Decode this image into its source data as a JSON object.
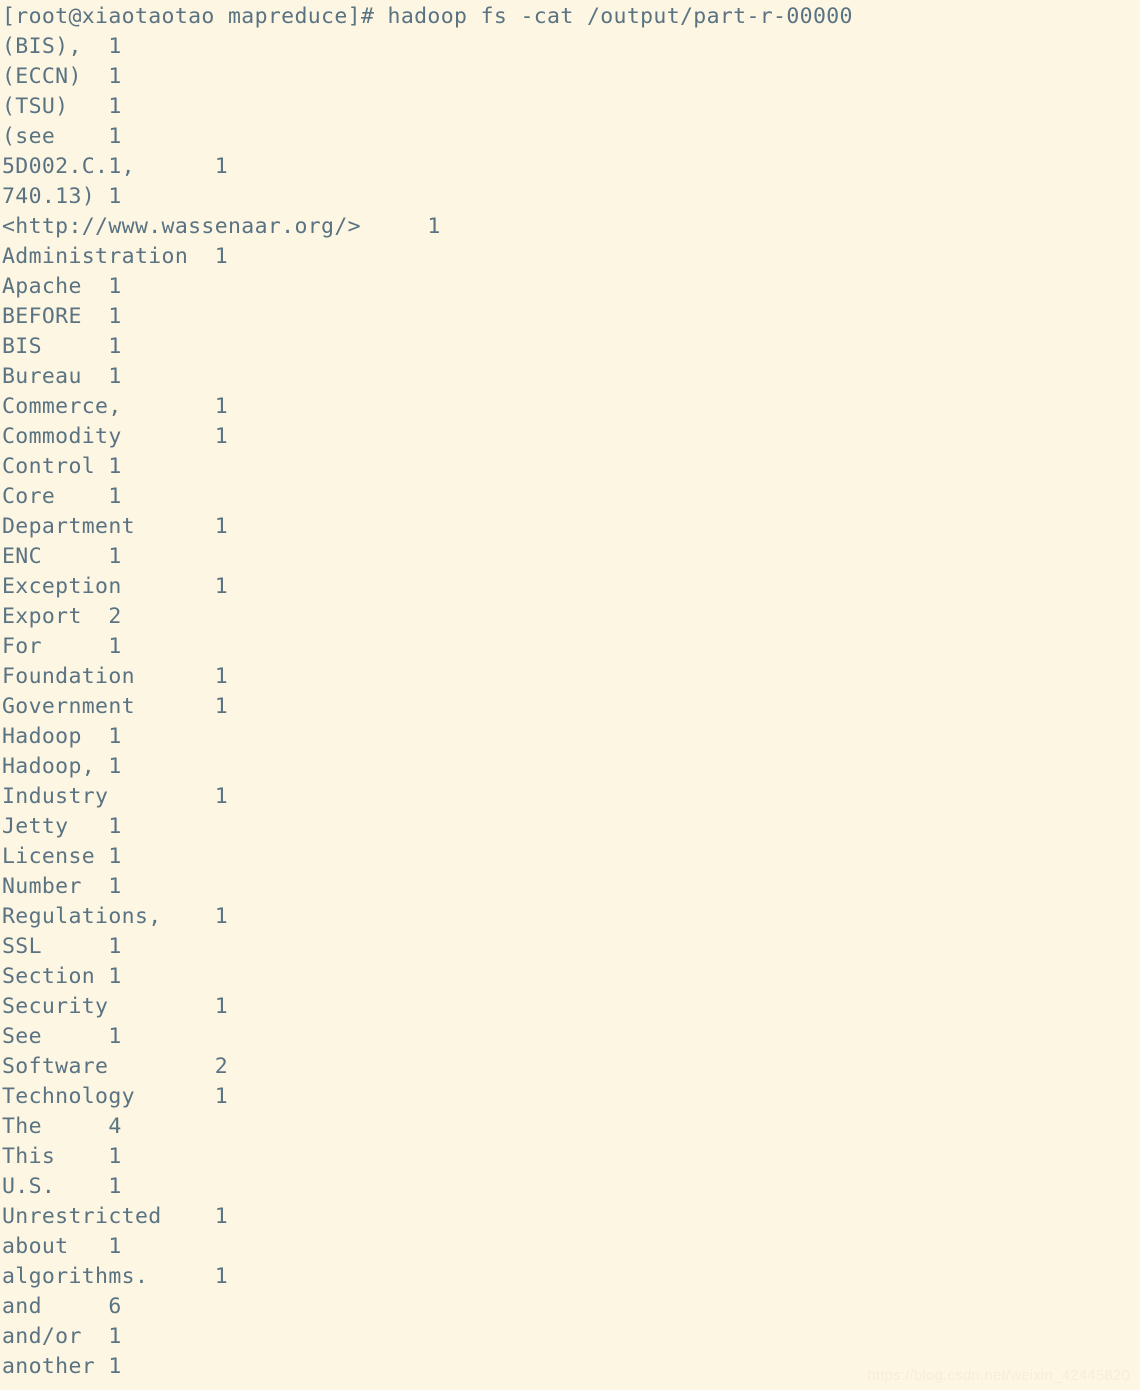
{
  "terminal": {
    "background_color": "#fdf6e3",
    "foreground_color": "#5a7383",
    "prompt": "[root@xiaotaotao mapreduce]# ",
    "command": "hadoop fs -cat /output/part-r-00000",
    "prompt_line": "[root@xiaotaotao mapreduce]# hadoop fs -cat /output/part-r-00000",
    "user": "root",
    "host": "xiaotaotao",
    "cwd": "mapreduce",
    "output_lines": [
      "(BIS),\t1",
      "(ECCN)\t1",
      "(TSU)\t1",
      "(see\t1",
      "5D002.C.1,\t1",
      "740.13)\t1",
      "<http://www.wassenaar.org/>\t1",
      "Administration\t1",
      "Apache\t1",
      "BEFORE\t1",
      "BIS\t1",
      "Bureau\t1",
      "Commerce,\t1",
      "Commodity\t1",
      "Control\t1",
      "Core\t1",
      "Department\t1",
      "ENC\t1",
      "Exception\t1",
      "Export\t2",
      "For\t1",
      "Foundation\t1",
      "Government\t1",
      "Hadoop\t1",
      "Hadoop,\t1",
      "Industry\t1",
      "Jetty\t1",
      "License\t1",
      "Number\t1",
      "Regulations,\t1",
      "SSL\t1",
      "Section\t1",
      "Security\t1",
      "See\t1",
      "Software\t2",
      "Technology\t1",
      "The\t4",
      "This\t1",
      "U.S.\t1",
      "Unrestricted\t1",
      "about\t1",
      "algorithms.\t1",
      "and\t6",
      "and/or\t1",
      "another\t1"
    ],
    "word_counts": [
      {
        "word": "(BIS),",
        "count": 1
      },
      {
        "word": "(ECCN)",
        "count": 1
      },
      {
        "word": "(TSU)",
        "count": 1
      },
      {
        "word": "(see",
        "count": 1
      },
      {
        "word": "5D002.C.1,",
        "count": 1
      },
      {
        "word": "740.13)",
        "count": 1
      },
      {
        "word": "<http://www.wassenaar.org/>",
        "count": 1
      },
      {
        "word": "Administration",
        "count": 1
      },
      {
        "word": "Apache",
        "count": 1
      },
      {
        "word": "BEFORE",
        "count": 1
      },
      {
        "word": "BIS",
        "count": 1
      },
      {
        "word": "Bureau",
        "count": 1
      },
      {
        "word": "Commerce,",
        "count": 1
      },
      {
        "word": "Commodity",
        "count": 1
      },
      {
        "word": "Control",
        "count": 1
      },
      {
        "word": "Core",
        "count": 1
      },
      {
        "word": "Department",
        "count": 1
      },
      {
        "word": "ENC",
        "count": 1
      },
      {
        "word": "Exception",
        "count": 1
      },
      {
        "word": "Export",
        "count": 2
      },
      {
        "word": "For",
        "count": 1
      },
      {
        "word": "Foundation",
        "count": 1
      },
      {
        "word": "Government",
        "count": 1
      },
      {
        "word": "Hadoop",
        "count": 1
      },
      {
        "word": "Hadoop,",
        "count": 1
      },
      {
        "word": "Industry",
        "count": 1
      },
      {
        "word": "Jetty",
        "count": 1
      },
      {
        "word": "License",
        "count": 1
      },
      {
        "word": "Number",
        "count": 1
      },
      {
        "word": "Regulations,",
        "count": 1
      },
      {
        "word": "SSL",
        "count": 1
      },
      {
        "word": "Section",
        "count": 1
      },
      {
        "word": "Security",
        "count": 1
      },
      {
        "word": "See",
        "count": 1
      },
      {
        "word": "Software",
        "count": 2
      },
      {
        "word": "Technology",
        "count": 1
      },
      {
        "word": "The",
        "count": 4
      },
      {
        "word": "This",
        "count": 1
      },
      {
        "word": "U.S.",
        "count": 1
      },
      {
        "word": "Unrestricted",
        "count": 1
      },
      {
        "word": "about",
        "count": 1
      },
      {
        "word": "algorithms.",
        "count": 1
      },
      {
        "word": "and",
        "count": 6
      },
      {
        "word": "and/or",
        "count": 1
      },
      {
        "word": "another",
        "count": 1
      }
    ]
  },
  "watermark": {
    "text": "https://blog.csdn.net/weixin_42445820"
  }
}
